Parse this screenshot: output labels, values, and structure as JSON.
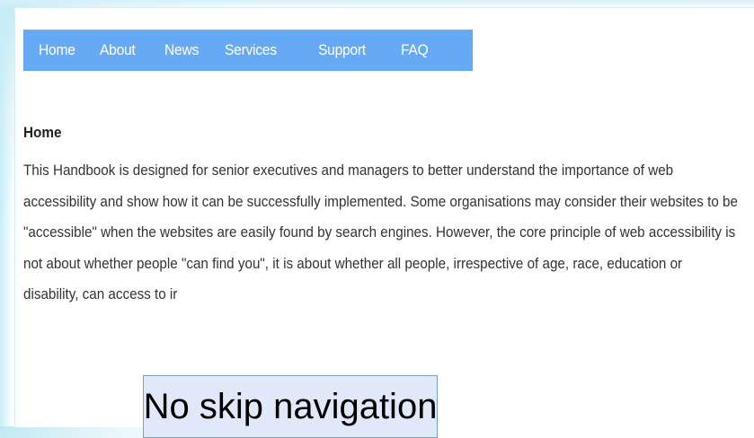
{
  "nav": {
    "items": [
      {
        "label": "Home"
      },
      {
        "label": "About"
      },
      {
        "label": "News"
      },
      {
        "label": "Services"
      },
      {
        "label": "Support"
      },
      {
        "label": "FAQ"
      }
    ]
  },
  "content": {
    "heading": "Home",
    "paragraph": "This Handbook is designed for senior executives and managers to better understand the importance of web accessibility and show how it can be successfully implemented. Some organisations may consider their websites to be \"accessible\" when the websites are easily found by search engines. However, the core principle of web accessibility is not about whether people \"can find you\", it is about whether all people, irrespective of age, race, education or disability, can access to ir"
  },
  "caption": {
    "text": "No skip navigation"
  },
  "colors": {
    "nav_background": "#66aaf6",
    "nav_text": "#ffffff",
    "caption_background": "#dfe9f9",
    "caption_border": "#7d9fd0"
  }
}
